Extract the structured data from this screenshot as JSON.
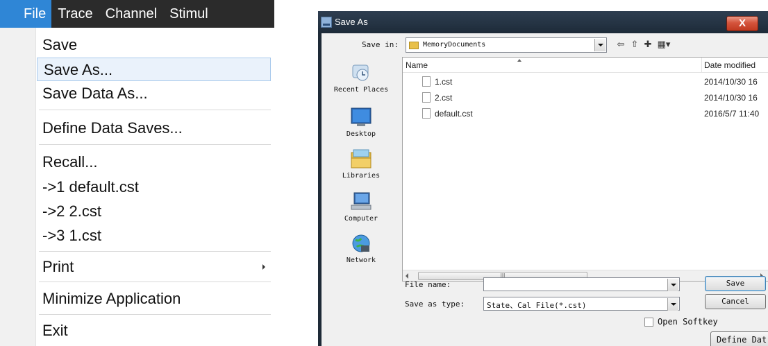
{
  "menu": {
    "menubar": [
      "File",
      "Trace",
      "Channel",
      "Stimul"
    ],
    "items": {
      "save": "Save",
      "save_as": "Save As...",
      "save_data_as": "Save Data As...",
      "define_data_saves": "Define Data Saves...",
      "recall": "Recall...",
      "recent_1": "->1 default.cst",
      "recent_2": "->2 2.cst",
      "recent_3": "->3 1.cst",
      "print": "Print",
      "minimize": "Minimize Application",
      "exit": "Exit"
    },
    "highlighted_item": "Save As..."
  },
  "dialog": {
    "title": "Save As",
    "close_glyph": "X",
    "save_in_label": "Save in:",
    "save_in_value": "MemoryDocuments",
    "places": [
      "Recent Places",
      "Desktop",
      "Libraries",
      "Computer",
      "Network"
    ],
    "columns": {
      "name": "Name",
      "date": "Date modified"
    },
    "files": [
      {
        "name": "1.cst",
        "date": "2014/10/30 16"
      },
      {
        "name": "2.cst",
        "date": "2014/10/30 16"
      },
      {
        "name": "default.cst",
        "date": "2016/5/7 11:40"
      }
    ],
    "scroll_grip": "III",
    "file_name_label": "File name:",
    "file_name_value": "",
    "save_type_label": "Save as type:",
    "save_type_value": "State、Cal File(*.cst)",
    "save_button": "Save",
    "cancel_button": "Cancel",
    "open_softkey_label": "Open Softkey",
    "open_softkey_checked": false,
    "define_button": "Define Dat"
  },
  "colors": {
    "menubar_bg": "#2b2b2b",
    "menubar_active": "#2f86d6",
    "menu_hover_bg": "#eaf2fb",
    "dialog_frame": "#1e2a37",
    "close_button": "#d5543c"
  }
}
